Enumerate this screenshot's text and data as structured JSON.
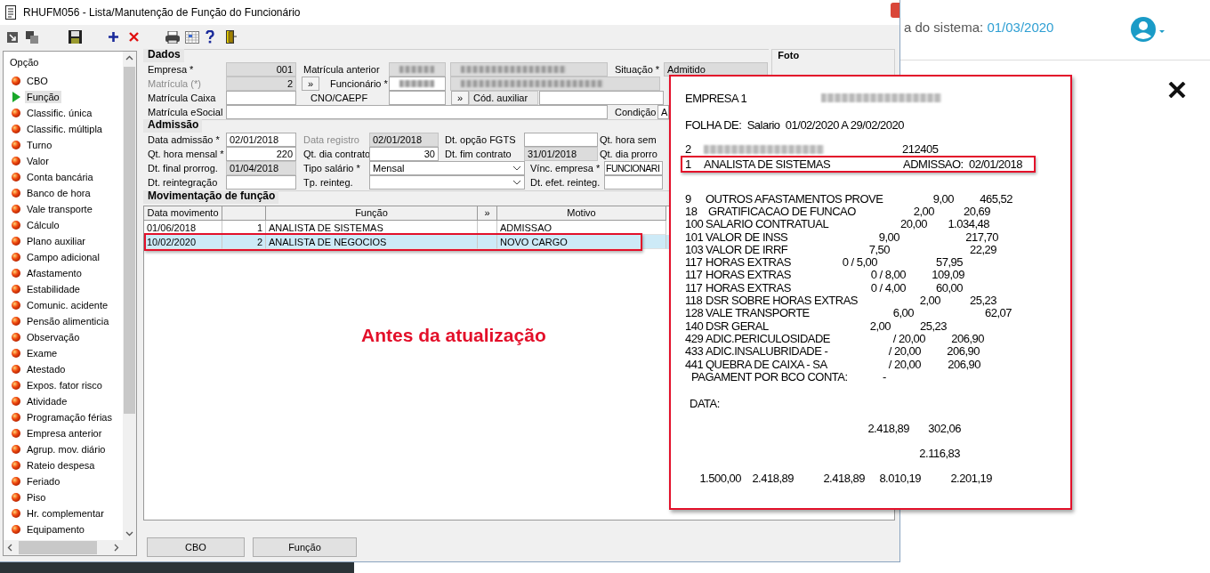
{
  "web_page": {
    "system_date_label": "a do sistema:",
    "system_date": "01/03/2020"
  },
  "window": {
    "title": "RHUFM056 - Lista/Manutenção de Função do Funcionário"
  },
  "sidebar": {
    "header": "Opção",
    "items": [
      {
        "label": "CBO",
        "selected": false
      },
      {
        "label": "Função",
        "selected": true
      },
      {
        "label": "Classific. única",
        "selected": false
      },
      {
        "label": "Classific. múltipla",
        "selected": false
      },
      {
        "label": "Turno",
        "selected": false
      },
      {
        "label": "Valor",
        "selected": false
      },
      {
        "label": "Conta bancária",
        "selected": false
      },
      {
        "label": "Banco de hora",
        "selected": false
      },
      {
        "label": "Vale transporte",
        "selected": false
      },
      {
        "label": "Cálculo",
        "selected": false
      },
      {
        "label": "Plano auxiliar",
        "selected": false
      },
      {
        "label": "Campo adicional",
        "selected": false
      },
      {
        "label": "Afastamento",
        "selected": false
      },
      {
        "label": "Estabilidade",
        "selected": false
      },
      {
        "label": "Comunic. acidente",
        "selected": false
      },
      {
        "label": "Pensão alimenticia",
        "selected": false
      },
      {
        "label": "Observação",
        "selected": false
      },
      {
        "label": "Exame",
        "selected": false
      },
      {
        "label": "Atestado",
        "selected": false
      },
      {
        "label": "Expos. fator risco",
        "selected": false
      },
      {
        "label": "Atividade",
        "selected": false
      },
      {
        "label": "Programação férias",
        "selected": false
      },
      {
        "label": "Empresa anterior",
        "selected": false
      },
      {
        "label": "Agrup. mov. diário",
        "selected": false
      },
      {
        "label": "Rateio despesa",
        "selected": false
      },
      {
        "label": "Feriado",
        "selected": false
      },
      {
        "label": "Piso",
        "selected": false
      },
      {
        "label": "Hr. complementar",
        "selected": false
      },
      {
        "label": "Equipamento",
        "selected": false
      }
    ]
  },
  "dados": {
    "title": "Dados",
    "rows": [
      [
        {
          "label": {
            "kind": "label",
            "text": "Empresa *"
          },
          "controls": [
            {
              "kind": "number",
              "value": "001",
              "readonly": true
            }
          ]
        },
        {
          "label": {
            "kind": "label",
            "text": "Matrícula anterior"
          },
          "controls": [
            {
              "kind": "redacted",
              "readonly": true
            },
            {
              "kind": "redacted",
              "readonly": true
            }
          ]
        },
        {
          "label": {
            "kind": "label",
            "text": "Situação *"
          },
          "controls": [
            {
              "kind": "input",
              "value": "Admitido",
              "readonly": true
            }
          ]
        }
      ],
      [
        {
          "label": {
            "kind": "muted_label",
            "text": "Matrícula (*)"
          },
          "controls": [
            {
              "kind": "number",
              "value": "2",
              "readonly": true
            }
          ]
        },
        {
          "label": {
            "kind": "label",
            "text": "Funcionário *",
            "lookup_button": "»"
          },
          "controls": [
            {
              "kind": "redacted",
              "readonly": false
            },
            {
              "kind": "redacted",
              "readonly": true
            }
          ]
        }
      ],
      [
        {
          "label": {
            "kind": "label",
            "text": "Matrícula Caixa"
          },
          "controls": [
            {
              "kind": "input",
              "readonly": false
            }
          ]
        },
        {
          "label": {
            "kind": "label",
            "text": "CNO/CAEPF"
          },
          "controls": [
            {
              "kind": "input",
              "readonly": false
            },
            {
              "kind": "caption_button",
              "text": "Cód. auxiliar",
              "lookup_button": "»"
            },
            {
              "kind": "input",
              "readonly": false
            }
          ]
        }
      ],
      [
        {
          "label": {
            "kind": "label",
            "text": "Matrícula eSocial"
          },
          "controls": [
            {
              "kind": "input",
              "readonly": false
            },
            {
              "kind": "inline_label",
              "text": "Condição"
            },
            {
              "kind": "input",
              "value": "A",
              "readonly": false
            }
          ]
        }
      ]
    ]
  },
  "admissao": {
    "title": "Admissão",
    "rows": [
      [
        {
          "label": {
            "kind": "label",
            "text": "Data admissão *"
          },
          "controls": [
            {
              "kind": "input",
              "value": "02/01/2018",
              "readonly": false
            }
          ]
        },
        {
          "label": {
            "kind": "muted_label",
            "text": "Data registro"
          },
          "controls": [
            {
              "kind": "input",
              "value": "02/01/2018",
              "readonly": true
            }
          ]
        },
        {
          "label": {
            "kind": "label",
            "text": "Dt. opção FGTS"
          },
          "controls": [
            {
              "kind": "input",
              "readonly": false
            }
          ]
        },
        {
          "label": {
            "kind": "label",
            "text": "Qt. hora sem"
          }
        }
      ],
      [
        {
          "label": {
            "kind": "label",
            "text": "Qt. hora mensal *"
          },
          "controls": [
            {
              "kind": "number",
              "value": "220",
              "readonly": false
            }
          ]
        },
        {
          "label": {
            "kind": "label",
            "text": "Qt. dia contrato"
          },
          "controls": [
            {
              "kind": "number",
              "value": "30",
              "readonly": false
            }
          ]
        },
        {
          "label": {
            "kind": "label",
            "text": "Dt. fim contrato"
          },
          "controls": [
            {
              "kind": "input",
              "value": "31/01/2018",
              "readonly": true
            }
          ]
        },
        {
          "label": {
            "kind": "label",
            "text": "Qt. dia prorro"
          }
        }
      ],
      [
        {
          "label": {
            "kind": "label",
            "text": "Dt. final prorrog."
          },
          "controls": [
            {
              "kind": "input",
              "value": "01/04/2018",
              "readonly": true
            }
          ]
        },
        {
          "label": {
            "kind": "label",
            "text": "Tipo salário *"
          },
          "controls": [
            {
              "kind": "select",
              "value": "Mensal"
            }
          ]
        },
        {
          "label": {
            "kind": "label",
            "text": "Vínc. empresa *"
          },
          "controls": [
            {
              "kind": "input",
              "value": "FUNCIONARI",
              "readonly": false
            }
          ]
        }
      ],
      [
        {
          "label": {
            "kind": "label",
            "text": "Dt. reintegração"
          },
          "controls": [
            {
              "kind": "input",
              "readonly": false
            }
          ]
        },
        {
          "label": {
            "kind": "label",
            "text": "Tp. reinteg."
          },
          "controls": [
            {
              "kind": "select"
            }
          ]
        },
        {
          "label": {
            "kind": "label",
            "text": "Dt. efet. reinteg."
          },
          "controls": [
            {
              "kind": "input",
              "readonly": false
            }
          ]
        }
      ]
    ]
  },
  "foto": {
    "title": "Foto"
  },
  "movimentacao": {
    "title": "Movimentação de função",
    "columns": [
      "Data movimento",
      "Função",
      "Motivo"
    ],
    "expand_button": "»",
    "rows": [
      {
        "date": "01/06/2018",
        "number": "1",
        "function": "ANALISTA DE SISTEMAS",
        "reason": "ADMISSAO",
        "selected": false,
        "marked": false
      },
      {
        "date": "10/02/2020",
        "number": "2",
        "function": "ANALISTA DE NEGOCIOS",
        "reason": "NOVO CARGO",
        "selected": true,
        "marked": true
      }
    ],
    "annotation": "Antes da atualização"
  },
  "buttons": [
    "CBO",
    "Função"
  ],
  "report": {
    "company": "EMPRESA 1",
    "period": "FOLHA DE:  Salario  01/02/2020 A 29/02/2020",
    "employee": {
      "number": "2",
      "code": "212405"
    },
    "function_line": {
      "number": "1",
      "function": "ANALISTA DE SISTEMAS",
      "admission": "ADMISSAO:  02/01/2018",
      "marked": true
    },
    "items": [
      {
        "code": "9",
        "description": "OUTROS AFASTAMENTOS PROVE",
        "quantity": "9,00",
        "value": "465,52"
      },
      {
        "code": "18",
        "description": " GRATIFICACAO DE FUNCAO",
        "quantity": "2,00",
        "value": "20,69"
      },
      {
        "code": "100",
        "description": "SALARIO CONTRATUAL",
        "quantity": "20,00",
        "value": "1.034,48"
      },
      {
        "code": "101",
        "description": "VALOR DE INSS",
        "quantity": "9,00",
        "value": "217,70"
      },
      {
        "code": "103",
        "description": "VALOR DE IRRF",
        "quantity": "7,50",
        "value": "22,29"
      },
      {
        "code": "117",
        "description": "HORAS EXTRAS",
        "quantity": "0 / 5,00",
        "value": "57,95"
      },
      {
        "code": "117",
        "description": "HORAS EXTRAS",
        "quantity": "0 / 8,00",
        "value": "109,09"
      },
      {
        "code": "117",
        "description": "HORAS EXTRAS",
        "quantity": "0 / 4,00",
        "value": "60,00"
      },
      {
        "code": "118",
        "description": "DSR SOBRE HORAS EXTRAS",
        "quantity": "2,00",
        "value": "25,23"
      },
      {
        "code": "128",
        "description": "VALE TRANSPORTE",
        "quantity": "6,00",
        "value": "62,07"
      },
      {
        "code": "140",
        "description": "DSR GERAL",
        "quantity": "2,00",
        "value": "25,23"
      },
      {
        "code": "429",
        "description": "ADIC.PERICULOSIDADE",
        "quantity": "/ 20,00",
        "value": "206,90"
      },
      {
        "code": "433",
        "description": "ADIC.INSALUBRIDADE -",
        "quantity": "/ 20,00",
        "value": "206,90"
      },
      {
        "code": "441",
        "description": "QUEBRA DE CAIXA - SA",
        "quantity": "/ 20,00",
        "value": "206,90"
      }
    ],
    "payment": {
      "label": "PAGAMENT POR BCO CONTA:",
      "value": "-"
    },
    "date_label": "DATA:",
    "totals": [
      [
        "2.418,89",
        "302,06"
      ],
      [
        "2.116,83"
      ],
      [
        "1.500,00",
        "2.418,89",
        "2.418,89",
        "8.010,19",
        "2.201,19"
      ]
    ]
  }
}
